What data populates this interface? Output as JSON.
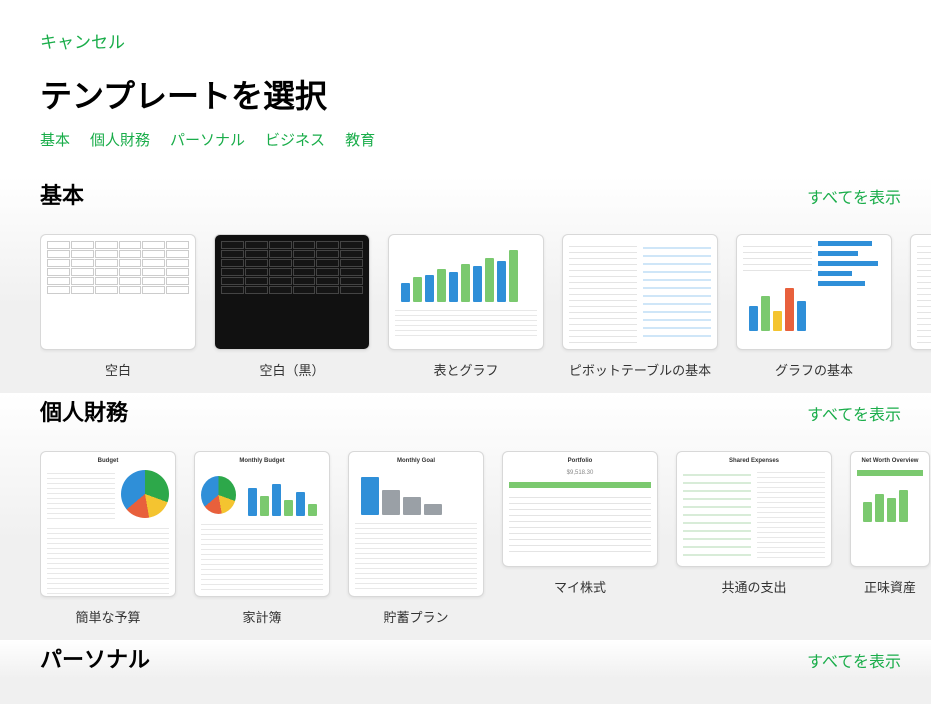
{
  "header": {
    "cancel": "キャンセル",
    "title": "テンプレートを選択"
  },
  "tabs": [
    "基本",
    "個人財務",
    "パーソナル",
    "ビジネス",
    "教育"
  ],
  "categories": [
    {
      "title": "基本",
      "showAll": "すべてを表示",
      "templates": [
        {
          "label": "空白"
        },
        {
          "label": "空白（黒）"
        },
        {
          "label": "表とグラフ"
        },
        {
          "label": "ピボットテーブルの基本"
        },
        {
          "label": "グラフの基本"
        }
      ]
    },
    {
      "title": "個人財務",
      "showAll": "すべてを表示",
      "templates": [
        {
          "label": "簡単な予算"
        },
        {
          "label": "家計簿"
        },
        {
          "label": "貯蓄プラン"
        },
        {
          "label": "マイ株式"
        },
        {
          "label": "共通の支出"
        },
        {
          "label": "正味資産"
        }
      ]
    },
    {
      "title": "パーソナル",
      "showAll": "すべてを表示",
      "templates": []
    }
  ]
}
